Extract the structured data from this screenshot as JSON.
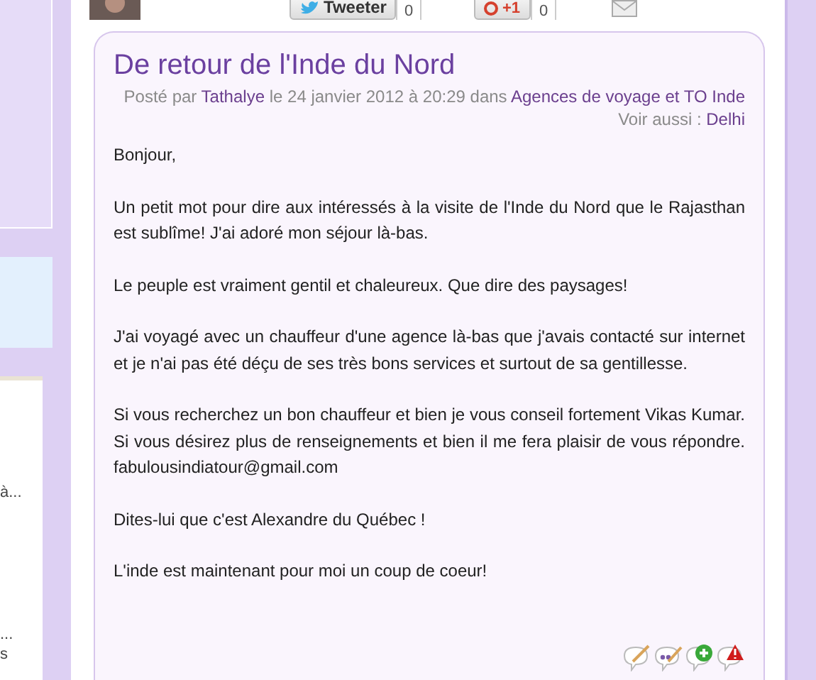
{
  "sidebar": {
    "snippets": [
      "à...",
      "...",
      "s"
    ]
  },
  "share_bar": {
    "tweet_button": "Tweeter",
    "tweet_count": "0",
    "plusone_button": "+1",
    "plusone_count": "0"
  },
  "post": {
    "title": "De retour de l'Inde du Nord",
    "meta": {
      "posted_by_label": "Posté par",
      "author": "Tathalye",
      "date": "le 24 janvier 2012 à 20:29 dans",
      "category": "Agences de voyage et TO Inde",
      "see_also_label": "Voir aussi :",
      "see_also": "Delhi"
    },
    "paragraphs": [
      "Bonjour,",
      "Un petit mot pour dire aux intéressés à la visite de l'Inde du Nord que le Rajasthan est sublîme! J'ai adoré mon séjour là-bas.",
      "Le peuple est vraiment gentil et chaleureux. Que dire des paysages!",
      "J'ai voyagé avec un chauffeur d'une agence là-bas que j'avais contacté sur internet et je n'ai pas été déçu de ses très bons services et surtout de sa gentillesse.",
      "Si vous recherchez un bon chauffeur et bien je vous conseil fortement Vikas Kumar. Si vous désirez plus de renseignements et bien il me fera plaisir de vous répondre. fabulousindiatour@gmail.com",
      "Dites-lui que c'est Alexandre du Québec !",
      "L'inde est maintenant pour moi un coup de coeur!"
    ],
    "actions": [
      {
        "kind": "edit"
      },
      {
        "kind": "reply"
      },
      {
        "kind": "add"
      },
      {
        "kind": "report"
      }
    ]
  }
}
